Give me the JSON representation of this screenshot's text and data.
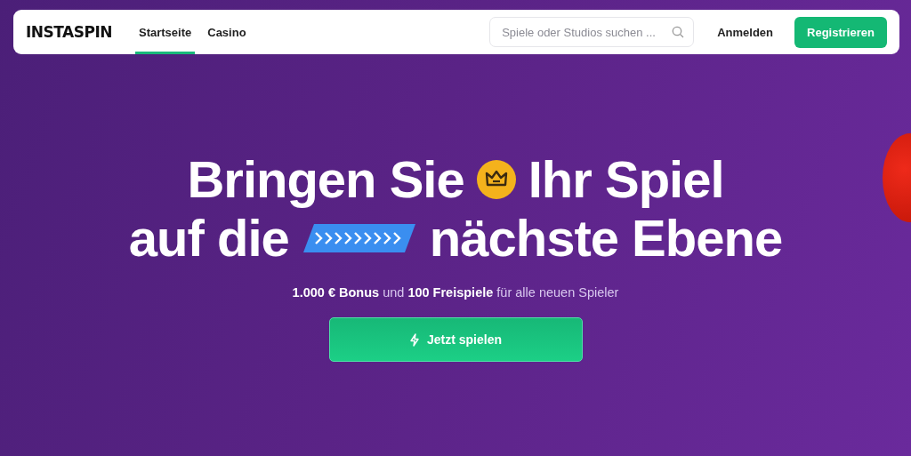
{
  "header": {
    "logo": "INSTASPIN",
    "nav": [
      {
        "label": "Startseite",
        "selected": true
      },
      {
        "label": "Casino",
        "selected": false
      }
    ],
    "search": {
      "placeholder": "Spiele oder Studios suchen ..."
    },
    "login": "Anmelden",
    "register": "Registrieren"
  },
  "hero": {
    "line_1": [
      "Bringen Sie",
      "Ihr Spiel"
    ],
    "line_2": [
      "auf die",
      "nächste Ebene"
    ],
    "subtitle": "**1.000 € Bonus** und **100 Freispiele** für alle neuen Spieler",
    "cta": "Jetzt spielen"
  }
}
